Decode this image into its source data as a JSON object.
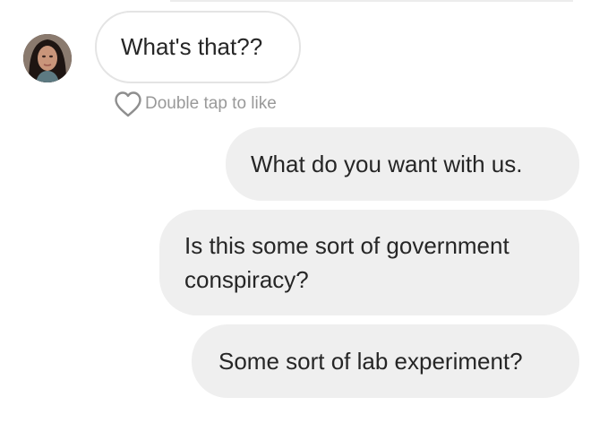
{
  "colors": {
    "received_border": "#e4e4e4",
    "sent_bubble_bg": "#efefef",
    "text": "#262626",
    "muted_text": "#999999"
  },
  "messages": [
    {
      "direction": "received",
      "text": "What's that??"
    },
    {
      "direction": "sent",
      "text": "What do you want with us."
    },
    {
      "direction": "sent",
      "text": "Is this some sort of government conspiracy?"
    },
    {
      "direction": "sent",
      "text": "Some sort of lab experiment?"
    }
  ],
  "like_prompt": {
    "icon": "heart-outline-icon",
    "text": "Double tap to like"
  }
}
